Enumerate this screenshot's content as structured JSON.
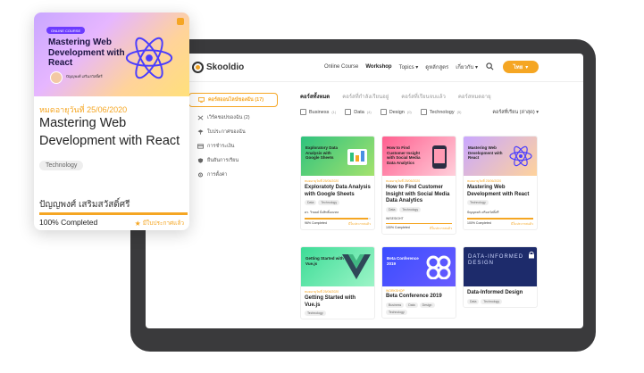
{
  "brand": {
    "name": "Skooldio",
    "accent": "#f5a623"
  },
  "nav": {
    "links": [
      "Online Course",
      "Workshop",
      "Topics",
      "ดูหลักสูตร",
      "เกี่ยวกับ"
    ],
    "active": "Workshop",
    "search_icon": "search-icon",
    "lang_button": "ไทย"
  },
  "sidebar": {
    "items": [
      {
        "label": "คอร์สออนไลน์ของฉัน (17)",
        "icon": "monitor-icon",
        "active": true
      },
      {
        "label": "เวิร์คชอปของฉัน (2)",
        "icon": "tools-icon",
        "active": false
      },
      {
        "label": "ใบประกาศของฉัน",
        "icon": "certificate-icon",
        "active": false
      },
      {
        "label": "การชำระเงิน",
        "icon": "card-icon",
        "active": false
      },
      {
        "label": "ยืนยันการเรียน",
        "icon": "shield-icon",
        "active": false
      },
      {
        "label": "การตั้งค่า",
        "icon": "gear-icon",
        "active": false
      }
    ]
  },
  "tabs": [
    "คอร์สทั้งหมด",
    "คอร์สที่กำลังเรียนอยู่",
    "คอร์สที่เรียนจบแล้ว",
    "คอร์สหมดอายุ"
  ],
  "filters": [
    {
      "label": "Business",
      "count": "(1)"
    },
    {
      "label": "Data",
      "count": "(4)"
    },
    {
      "label": "Design",
      "count": "(0)"
    },
    {
      "label": "Technology",
      "count": "(5)"
    }
  ],
  "sort_label": "คอร์สที่เรียน (ล่าสุด)",
  "courses": [
    {
      "thumb_title": "Exploratory Data Analysis with Google Sheets",
      "date": "หมดอายุวันที่ 25/06/2020",
      "title": "Exploratoty Data Analysis with Google Sheets",
      "tags": [
        "Data",
        "Technology"
      ],
      "who": "ดร. วิรยยย์ มิ่งสิทธิ์มณฑล",
      "progress": 0.96,
      "pct": "96% Completed",
      "status": "มีใบประกาศแล้ว"
    },
    {
      "thumb_title": "How to Find Customer Insight with Social Media Data Analytics",
      "date": "หมดอายุวันที่ 25/06/2020",
      "title": "How to Find Customer Insight with Social Media Data Analytics",
      "tags": [
        "Data",
        "Technology"
      ],
      "who": "WISESIGHT",
      "progress": 1.0,
      "pct": "100% Completed",
      "status": "มีใบประกาศแล้ว"
    },
    {
      "thumb_title": "Mastering Web Development with React",
      "date": "หมดอายุวันที่ 25/06/2020",
      "title": "Mastering Web Development with React",
      "tags": [
        "Technology"
      ],
      "who": "ปัญญพงศ์ เสริมสวัสดิ์ศรี",
      "progress": 1.0,
      "pct": "100% Completed",
      "status": "มีใบประกาศแล้ว"
    },
    {
      "thumb_title": "Getting Started with Vue.js",
      "date": "หมดอายุวันที่ 25/06/2020",
      "title": "Getting Started with Vue.js",
      "tags": [
        "Technology"
      ]
    },
    {
      "thumb_title": "Beta Conference 2019",
      "date": "WORKSHOP",
      "title": "Beta Conference 2019",
      "tags": [
        "Business",
        "Data",
        "Design",
        "Technology"
      ]
    },
    {
      "thumb_title": "DATA-INFORMED DESIGN",
      "date": "",
      "title": "Data-Informed Design",
      "tags": [
        "Data",
        "Technology"
      ]
    }
  ],
  "featured": {
    "badge": "ONLINE COURSE",
    "thumb_title": "Mastering Web Development with React",
    "instructor_line": "ปัญญพงศ์ เสริมสวัสดิ์ศรี",
    "expiry": "หมดอายุวันที่ 25/06/2020",
    "title": "Mastering Web Development with React",
    "tag": "Technology",
    "who": "ปัญญพงศ์ เสริมสวัสดิ์ศรี",
    "progress": 1.0,
    "pct": "100% Completed",
    "status": "มีใบประกาศแล้ว"
  }
}
